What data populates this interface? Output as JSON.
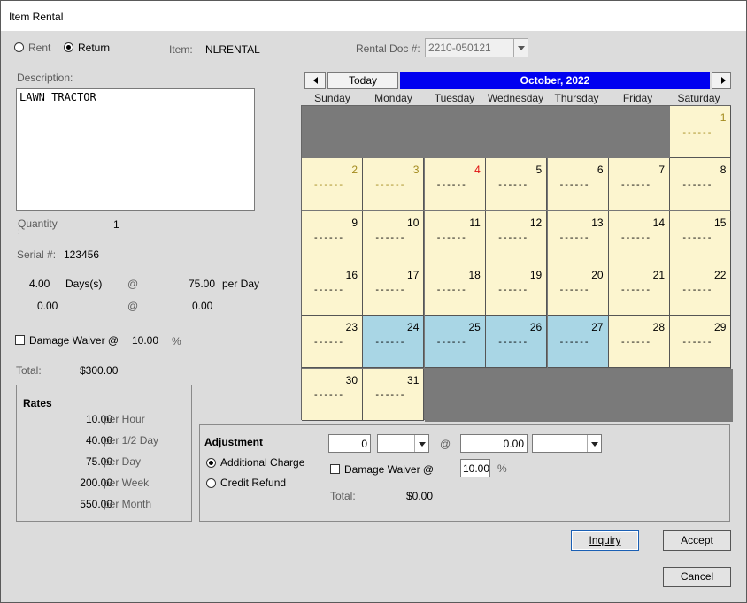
{
  "window": {
    "title": "Item Rental"
  },
  "mode": {
    "rent_label": "Rent",
    "return_label": "Return",
    "selected": "Return"
  },
  "item": {
    "label": "Item:",
    "value": "NLRENTAL"
  },
  "rental_doc": {
    "label": "Rental Doc #:",
    "value": "2210-050121"
  },
  "description": {
    "label": "Description:",
    "value": "LAWN TRACTOR"
  },
  "quantity": {
    "label": "Quantity",
    "colon": ":",
    "value": "1"
  },
  "serial": {
    "label": "Serial #:",
    "value": "123456"
  },
  "charges": {
    "line1": {
      "qty": "4.00",
      "unit": "Days(s)",
      "at": "@",
      "rate": "75.00",
      "per": "per Day"
    },
    "line2": {
      "qty": "0.00",
      "at": "@",
      "rate": "0.00"
    }
  },
  "damage_waiver": {
    "label": "Damage Waiver @",
    "value": "10.00",
    "pct": "%",
    "checked": false
  },
  "total": {
    "label": "Total:",
    "value": "$300.00"
  },
  "rates": {
    "title": "Rates",
    "items": [
      {
        "value": "10.00",
        "period": "per Hour"
      },
      {
        "value": "40.00",
        "period": "per 1/2 Day"
      },
      {
        "value": "75.00",
        "period": "per Day"
      },
      {
        "value": "200.00",
        "period": "per Week"
      },
      {
        "value": "550.00",
        "period": "per Month"
      }
    ]
  },
  "calendar": {
    "today_label": "Today",
    "month": "October, 2022",
    "weekdays": [
      "Sunday",
      "Monday",
      "Tuesday",
      "Wednesday",
      "Thursday",
      "Friday",
      "Saturday"
    ],
    "dash": "------",
    "highlight_days": [
      24,
      25,
      26,
      27
    ],
    "red_days": [
      4
    ],
    "olive_days": [
      1,
      2,
      3
    ]
  },
  "adjustment": {
    "title": "Adjustment",
    "additional_label": "Additional Charge",
    "refund_label": "Credit Refund",
    "selected": "Additional Charge",
    "qty": "0",
    "at": "@",
    "amount": "0.00",
    "waiver_label": "Damage Waiver @",
    "waiver_value": "10.00",
    "pct": "%",
    "total_label": "Total:",
    "total_value": "$0.00"
  },
  "buttons": {
    "inquiry": "Inquiry",
    "accept": "Accept",
    "cancel": "Cancel"
  },
  "colors": {
    "month_bar": "#0000f0",
    "cell": "#fcf5cf",
    "highlight": "#a9d6e5",
    "empty": "#7a7a7a"
  }
}
